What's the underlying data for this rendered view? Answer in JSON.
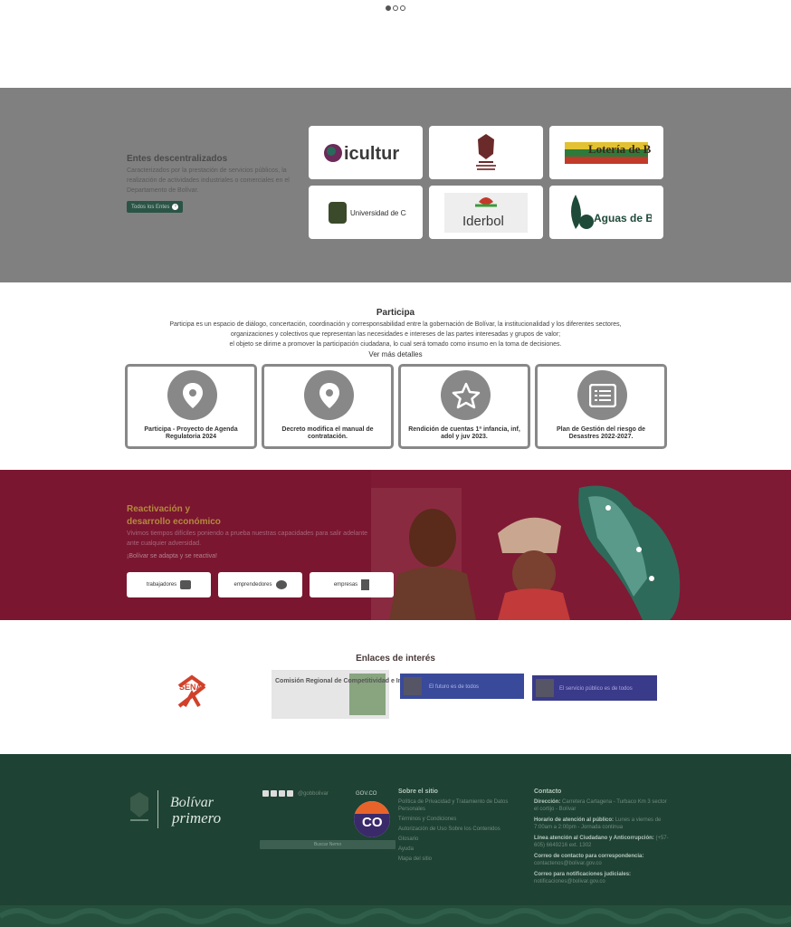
{
  "carousel": {
    "dots": 3,
    "active_index": 0
  },
  "entes": {
    "title": "Entes descentralizados",
    "description": "Caracterizados por la prestación de servicios públicos, la realización de actividades industriales o comerciales en el Departamento de Bolívar.",
    "button_label": "Todos los Entes",
    "logos": [
      {
        "name": "icultur",
        "text": "icultur"
      },
      {
        "name": "escudo-bolivar",
        "text": ""
      },
      {
        "name": "loteria-de-bolivar",
        "text": "Lotería de Bolívar"
      },
      {
        "name": "universidad-de-cartagena",
        "text": "Universidad de Cartagena"
      },
      {
        "name": "iderbol",
        "text": "Iderbol"
      },
      {
        "name": "aguas-de-bolivar",
        "text": "Aguas de Bolívar"
      }
    ]
  },
  "participa": {
    "title": "Participa",
    "description_lines": [
      "Participa es un espacio de diálogo, concertación, coordinación y corresponsabilidad entre la gobernación de Bolívar, la institucionalidad y los diferentes sectores,",
      "organizaciones y colectivos que representan las necesidades e intereses de las partes interesadas y grupos de valor;",
      "el objeto se dirime a promover la participación ciudadana, lo cual será tomado como insumo en la toma de decisiones."
    ],
    "more_label": "Ver más detalles",
    "cards": [
      {
        "icon": "map-pin",
        "label": "Participa - Proyecto de Agenda Regulatoria 2024"
      },
      {
        "icon": "map-pin",
        "label": "Decreto modifica el manual de contratación."
      },
      {
        "icon": "star",
        "label": "Rendición de cuentas 1ª infancia, inf, adol y juv 2023."
      },
      {
        "icon": "list",
        "label": "Plan de Gestión del riesgo de Desastres 2022-2027."
      }
    ]
  },
  "reactivacion": {
    "title_line1": "Reactivación y",
    "title_line2": "desarrollo económico",
    "description": "Vivimos tiempos difíciles poniendo a prueba nuestras capacidades para salir adelante ante cualquier adversidad.",
    "slogan": "¡Bolívar se adapta y se reactiva!",
    "buttons": [
      {
        "label": "trabajadores",
        "icon": "briefcase"
      },
      {
        "label": "emprendedores",
        "icon": "lightbulb-head"
      },
      {
        "label": "empresas",
        "icon": "building"
      }
    ]
  },
  "enlaces": {
    "title": "Enlaces de interés",
    "logos": [
      {
        "name": "sena",
        "text": "SENA"
      },
      {
        "name": "comision-regional",
        "text": "Comisión Regional de Competitividad e Innovación de Cartagena y Bolívar"
      },
      {
        "name": "el-futuro-es-de-todos",
        "text": "El futuro es de todos"
      },
      {
        "name": "funcion-publica",
        "text": "El servicio público es de todos"
      }
    ]
  },
  "footer": {
    "logo_text_1": "Bolívar",
    "logo_text_2": "primero",
    "social_handle": "@gobbolivar",
    "govco_label": "GOV.CO",
    "search_placeholder": "Buscar Nemo",
    "sitio": {
      "title": "Sobre el sitio",
      "links": [
        "Política de Privacidad y Tratamiento de Datos Personales",
        "Términos y Condiciones",
        "Autorización de Uso Sobre los Contenidos",
        "Glosario",
        "Ayuda",
        "Mapa del sitio"
      ]
    },
    "contacto": {
      "title": "Contacto",
      "rows": [
        {
          "label": "Dirección:",
          "value": "Carretera Cartagena - Turbaco Km 3 sector el cortijo - Bolívar"
        },
        {
          "label": "Horario de atención al público:",
          "value": "Lunes a viernes de 7:00am a 2:00pm - Jornada continua"
        },
        {
          "label": "Línea atención al Ciudadano y Anticorrupción:",
          "value": "(+57-605) 6649216 ext. 1302"
        },
        {
          "label": "Correo de contacto para correspondencia:",
          "value": "contactenos@bolivar.gov.co"
        },
        {
          "label": "Correo para notificaciones judiciales:",
          "value": "notificaciones@bolivar.gov.co"
        }
      ]
    }
  }
}
